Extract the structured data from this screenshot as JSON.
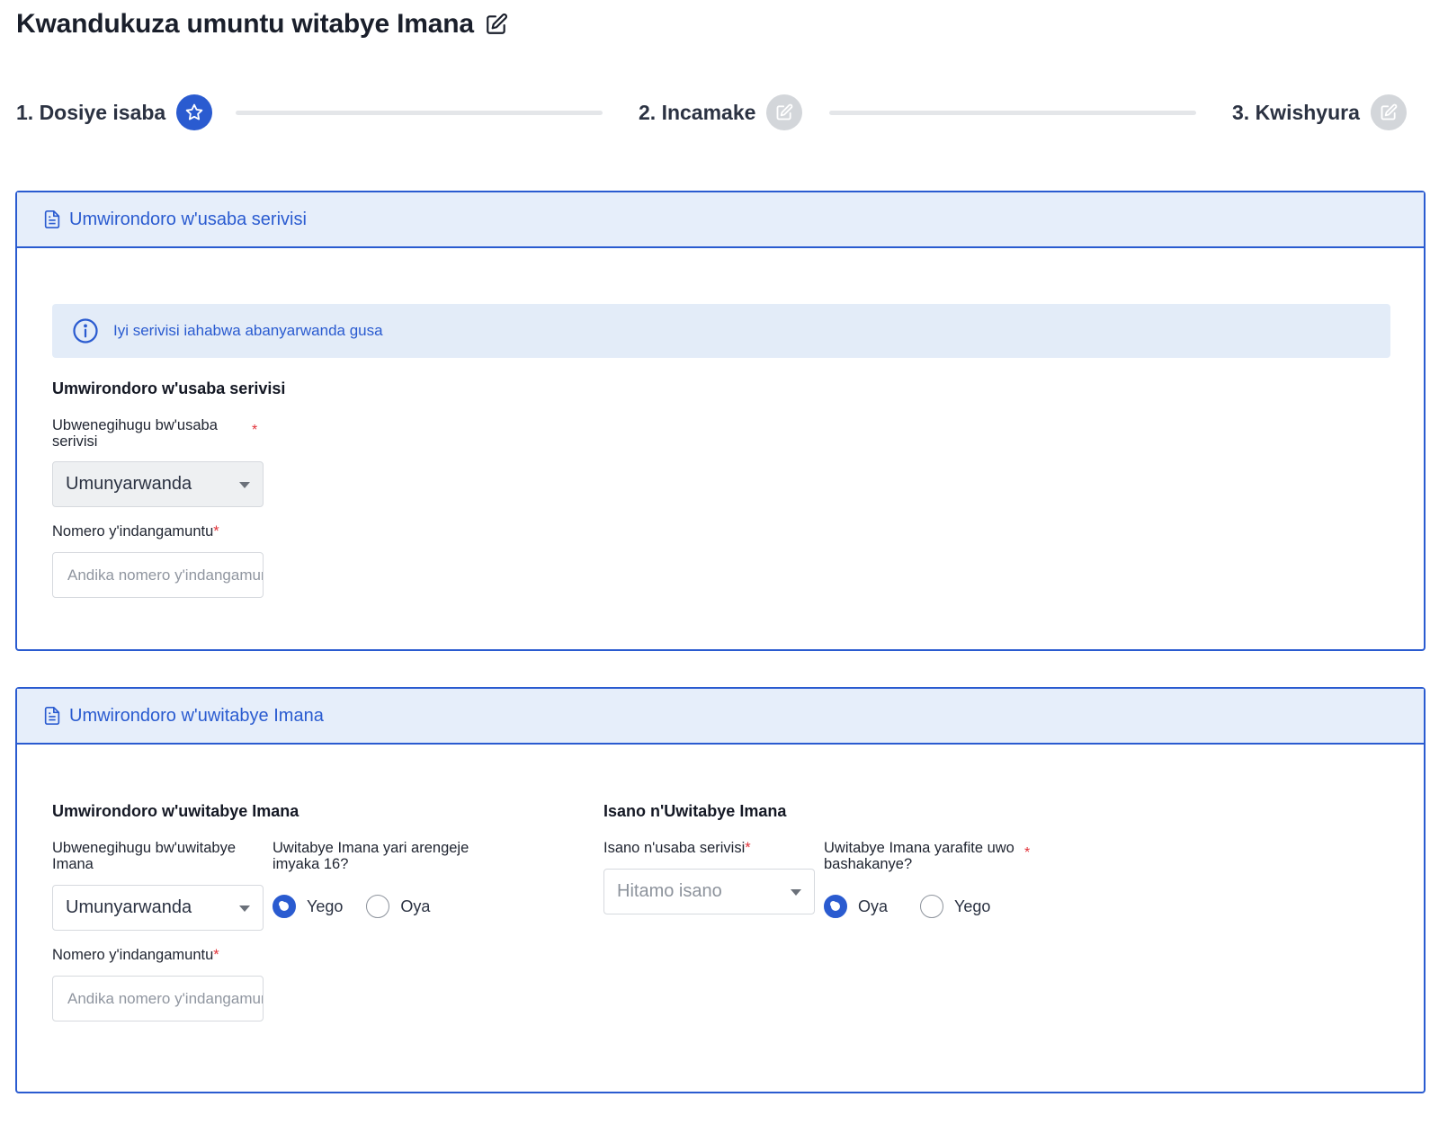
{
  "page": {
    "title": "Kwandukuza umuntu witabye Imana"
  },
  "stepper": {
    "steps": [
      {
        "label": "1. Dosiye isaba",
        "icon": "star-icon",
        "state": "active"
      },
      {
        "label": "2. Incamake",
        "icon": "edit-icon",
        "state": "inactive"
      },
      {
        "label": "3. Kwishyura",
        "icon": "edit-icon",
        "state": "inactive"
      }
    ]
  },
  "applicant_panel": {
    "header_title": "Umwirondoro w'usaba serivisi",
    "info_text": "Iyi serivisi iahabwa abanyarwanda gusa",
    "section_title": "Umwirondoro w'usaba serivisi",
    "nationality_label": "Ubwenegihugu bw'usaba serivisi",
    "nationality_value": "Umunyarwanda",
    "id_label": "Nomero y'indangamuntu",
    "id_value": "",
    "id_placeholder": "Andika nomero y'indangamuntu"
  },
  "deceased_panel": {
    "header_title": "Umwirondoro w'uwitabye Imana",
    "section_title": "Umwirondoro w'uwitabye Imana",
    "nationality_label": "Ubwenegihugu bw'uwitabye Imana",
    "nationality_value": "Umunyarwanda",
    "age_question": "Uwitabye Imana yari arengeje imyaka 16?",
    "age_options": [
      "Yego",
      "Oya"
    ],
    "age_selected": "Yego",
    "id_label": "Nomero y'indangamuntu",
    "id_value": "",
    "id_placeholder": "Andika nomero y'indangamuntu",
    "relation_section_title": "Isano n'Uwitabye Imana",
    "relation_label": "Isano n'usaba serivisi",
    "relation_placeholder": "Hitamo isano",
    "spouse_question": "Uwitabye Imana yarafite uwo bashakanye?",
    "spouse_options": [
      "Oya",
      "Yego"
    ],
    "spouse_selected": "Oya"
  },
  "colors": {
    "primary": "#2a5bd0",
    "header_bg": "#e6eefa",
    "required": "#e2343b",
    "inactive_step": "#d3d6da"
  }
}
